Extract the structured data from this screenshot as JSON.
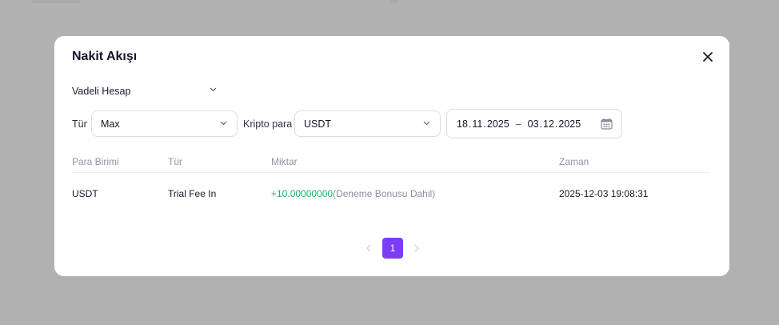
{
  "modal": {
    "title": "Nakit Akışı"
  },
  "account_select": {
    "value": "Vadeli Hesap"
  },
  "filters": {
    "type_label": "Tür",
    "type_value": "Max",
    "crypto_label": "Kripto para",
    "crypto_value": "USDT",
    "date_range": {
      "start": {
        "day": "18",
        "month": "11",
        "year": "2025"
      },
      "separator": "–",
      "end": {
        "day": "03",
        "month": "12",
        "year": "2025"
      }
    }
  },
  "table": {
    "columns": [
      "Para Birimi",
      "Tür",
      "Miktar",
      "Zaman"
    ],
    "rows": [
      {
        "currency": "USDT",
        "type": "Trial Fee In",
        "amount": "+10.00000000",
        "amount_note": "(Deneme Bonusu Dahil)",
        "time": "2025-12-03 19:08:31"
      }
    ]
  },
  "pagination": {
    "current_page": "1"
  },
  "colors": {
    "accent": "#7b3cf4",
    "positive": "#1fb36b",
    "overlay": "#b1b1b1"
  },
  "icons": [
    "close-icon",
    "chevron-down-icon",
    "calendar-icon",
    "chevron-left-icon",
    "chevron-right-icon"
  ]
}
